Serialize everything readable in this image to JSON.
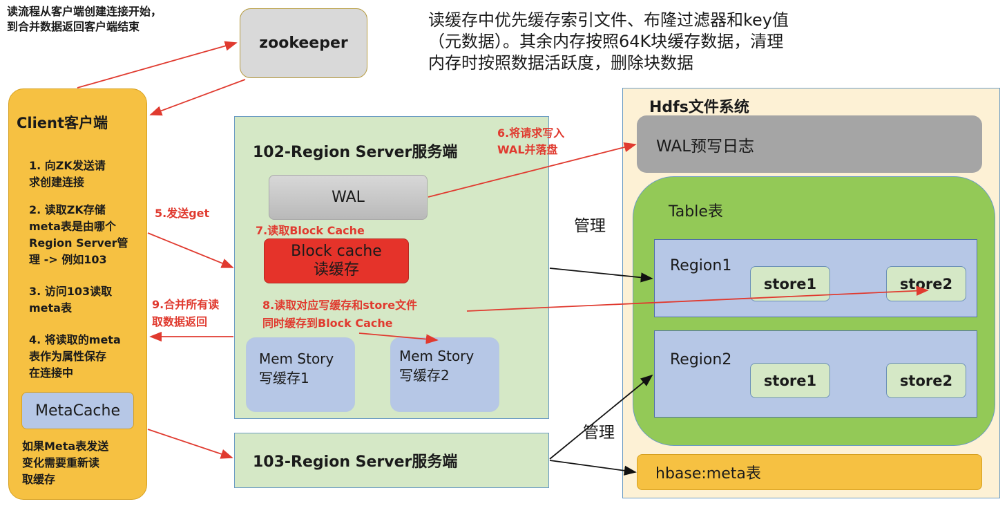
{
  "notes": {
    "top_left": "读流程从客户端创建连接开始，\n到合并数据返回客户端结束",
    "top_right": "读缓存中优先缓存索引文件、布隆过滤器和key值\n（元数据）。其余内存按照64K块缓存数据，清理\n内存时按照数据活跃度，删除块数据"
  },
  "zookeeper": {
    "label": "zookeeper"
  },
  "client": {
    "title": "Client客户端",
    "steps": [
      "1. 向ZK发送请\n求创建连接",
      "2. 读取ZK存储\nmeta表是由哪个\nRegion Server管\n理 -> 例如103",
      "3. 访问103读取\nmeta表",
      "4. 将读取的meta\n表作为属性保存\n在连接中"
    ],
    "metacache": "MetaCache",
    "footer": "如果Meta表发送\n变化需要重新读\n取缓存"
  },
  "rs102": {
    "title": "102-Region Server服务端",
    "wal": "WAL",
    "block_cache_line1": "Block cache",
    "block_cache_line2": "读缓存",
    "mem1": "Mem Story\n写缓存1",
    "mem2": "Mem Story\n写缓存2"
  },
  "rs103": {
    "title": "103-Region Server服务端"
  },
  "annotations": {
    "step5": "5.发送get",
    "step6": "6.将请求写入\nWAL并落盘",
    "step7": "7.读取Block Cache",
    "step8": "8.读取对应写缓存和store文件\n同时缓存到Block Cache",
    "step9": "9.合并所有读\n取数据返回",
    "manage1": "管理",
    "manage2": "管理"
  },
  "hdfs": {
    "title": "Hdfs文件系统",
    "wal_log": "WAL预写日志",
    "table": "Table表",
    "region1": {
      "label": "Region1",
      "stores": [
        "store1",
        "store2"
      ]
    },
    "region2": {
      "label": "Region2",
      "stores": [
        "store1",
        "store2"
      ]
    },
    "meta_table": "hbase:meta表"
  },
  "colors": {
    "client_fill": "#f6c142",
    "server_fill": "#d5e8c6",
    "block_cache": "#e5332a",
    "hdfs_fill": "#fdf1d5",
    "table_fill": "#93c957",
    "region_fill": "#b6c7e6",
    "store_fill": "#d5e8c6",
    "arrow_red": "#e03a2f"
  }
}
